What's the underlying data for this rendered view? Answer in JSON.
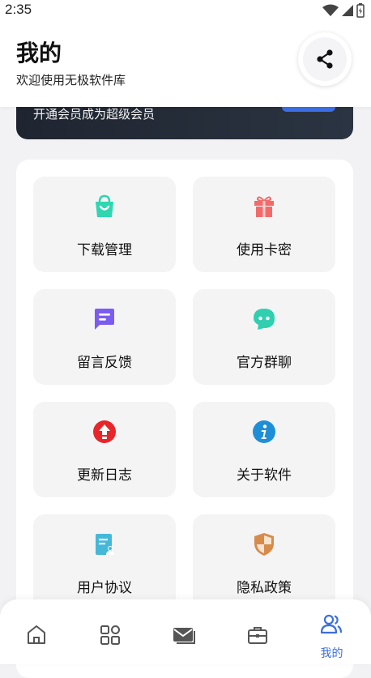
{
  "status": {
    "time": "2:35"
  },
  "header": {
    "title": "我的",
    "subtitle": "欢迎使用无极软件库",
    "share_icon": "share-icon"
  },
  "vip": {
    "text": "开通会员成为超级会员"
  },
  "menu": [
    {
      "label": "下载管理",
      "icon": "shopping-bag-icon"
    },
    {
      "label": "使用卡密",
      "icon": "gift-icon"
    },
    {
      "label": "留言反馈",
      "icon": "message-icon"
    },
    {
      "label": "官方群聊",
      "icon": "chat-bubble-icon"
    },
    {
      "label": "更新日志",
      "icon": "upload-arrow-icon"
    },
    {
      "label": "关于软件",
      "icon": "info-icon"
    },
    {
      "label": "用户协议",
      "icon": "document-icon"
    },
    {
      "label": "隐私政策",
      "icon": "shield-icon"
    }
  ],
  "bottom_nav": {
    "items": [
      {
        "icon": "home-icon",
        "label": ""
      },
      {
        "icon": "grid-icon",
        "label": ""
      },
      {
        "icon": "mail-icon",
        "label": ""
      },
      {
        "icon": "toolbox-icon",
        "label": ""
      },
      {
        "icon": "user-icon",
        "label": "我的",
        "active": true
      }
    ]
  },
  "colors": {
    "accent": "#3b6fe0",
    "banner": "#262d38",
    "bag": "#2fd6b0",
    "gift": "#f26b6b",
    "message": "#7c5cf0",
    "chat": "#2fcfb0",
    "update": "#e8262a",
    "info": "#1e8fd6",
    "document": "#45b8d8",
    "shield": "#d78b4a"
  }
}
